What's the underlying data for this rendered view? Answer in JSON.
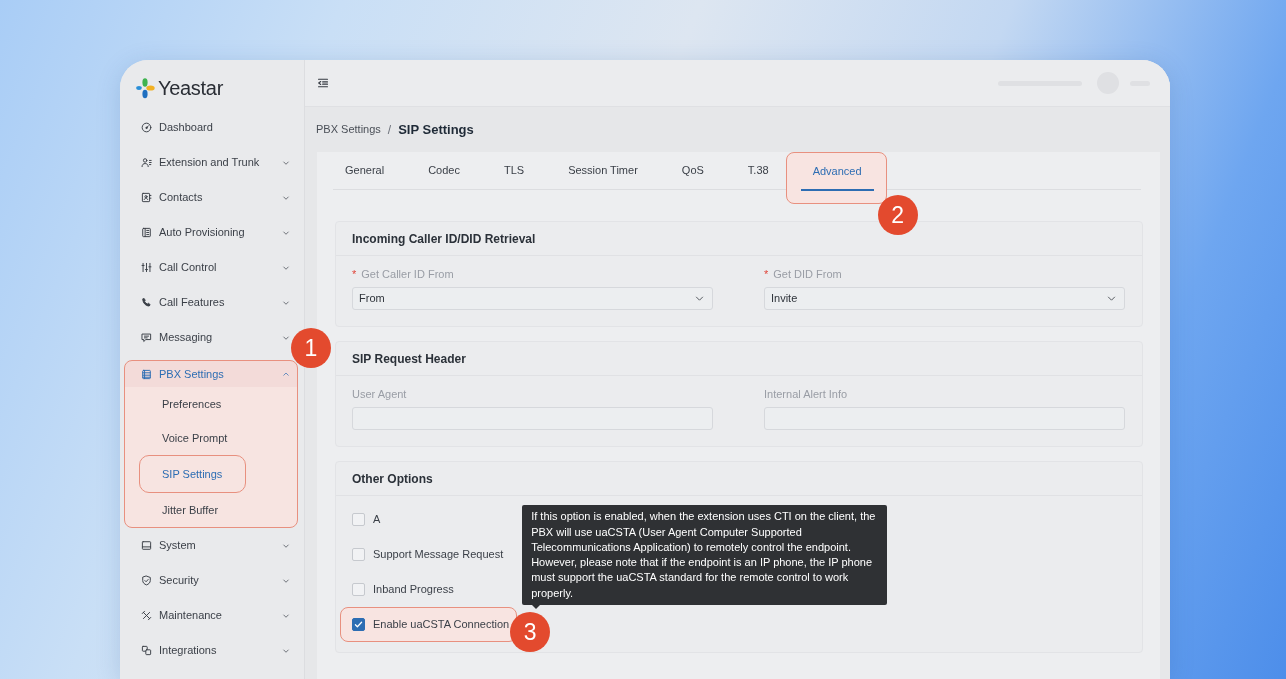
{
  "sidebar": {
    "logo_text": "Yeastar",
    "items": [
      {
        "label": "Dashboard",
        "kind": "link",
        "selected": false,
        "highlighted": false
      },
      {
        "label": "Extension and Trunk",
        "kind": "group",
        "expanded": false,
        "selected": false,
        "highlighted": false
      },
      {
        "label": "Contacts",
        "kind": "group",
        "expanded": false,
        "selected": false,
        "highlighted": false
      },
      {
        "label": "Auto Provisioning",
        "kind": "group",
        "expanded": false,
        "selected": false,
        "highlighted": false
      },
      {
        "label": "Call Control",
        "kind": "group",
        "expanded": false,
        "selected": false,
        "highlighted": false
      },
      {
        "label": "Call Features",
        "kind": "group",
        "expanded": false,
        "selected": false,
        "highlighted": false
      },
      {
        "label": "Messaging",
        "kind": "group",
        "expanded": false,
        "selected": false,
        "highlighted": false
      },
      {
        "label": "PBX Settings",
        "kind": "group",
        "expanded": true,
        "selected": true,
        "highlighted": true,
        "step_badge": "1",
        "children": [
          {
            "label": "Preferences",
            "selected": false,
            "highlighted": false
          },
          {
            "label": "Voice Prompt",
            "selected": false,
            "highlighted": false
          },
          {
            "label": "SIP Settings",
            "selected": true,
            "highlighted": true
          },
          {
            "label": "Jitter Buffer",
            "selected": false,
            "highlighted": false
          }
        ]
      },
      {
        "label": "System",
        "kind": "group",
        "expanded": false,
        "selected": false,
        "highlighted": false
      },
      {
        "label": "Security",
        "kind": "group",
        "expanded": false,
        "selected": false,
        "highlighted": false
      },
      {
        "label": "Maintenance",
        "kind": "group",
        "expanded": false,
        "selected": false,
        "highlighted": false
      },
      {
        "label": "Integrations",
        "kind": "group",
        "expanded": false,
        "selected": false,
        "highlighted": false
      }
    ]
  },
  "breadcrumb": {
    "parent": "PBX Settings",
    "separator": "/",
    "current": "SIP Settings"
  },
  "tabs": [
    {
      "label": "General",
      "selected": false,
      "highlighted": false
    },
    {
      "label": "Codec",
      "selected": false,
      "highlighted": false
    },
    {
      "label": "TLS",
      "selected": false,
      "highlighted": false
    },
    {
      "label": "Session Timer",
      "selected": false,
      "highlighted": false
    },
    {
      "label": "QoS",
      "selected": false,
      "highlighted": false
    },
    {
      "label": "T.38",
      "selected": false,
      "highlighted": false
    },
    {
      "label": "Advanced",
      "selected": true,
      "highlighted": true,
      "step_badge": "2"
    }
  ],
  "sections": [
    {
      "title": "Incoming Caller ID/DID Retrieval",
      "kind": "fields",
      "fields": [
        {
          "label": "Get Caller ID From",
          "required_mark": "*",
          "kind": "select",
          "value": "From"
        },
        {
          "label": "Get DID From",
          "required_mark": "*",
          "kind": "select",
          "value": "Invite"
        }
      ]
    },
    {
      "title": "SIP Request Header",
      "kind": "fields",
      "fields": [
        {
          "label": "User Agent",
          "kind": "text"
        },
        {
          "label": "Internal Alert Info",
          "kind": "text"
        }
      ]
    },
    {
      "title": "Other Options",
      "kind": "options",
      "options": [
        {
          "label": "A",
          "checked": false,
          "highlighted": false
        },
        {
          "label": "Support Message Request",
          "checked": false,
          "highlighted": false
        },
        {
          "label": "Inband Progress",
          "checked": false,
          "highlighted": false
        },
        {
          "label": "Enable uaCSTA Connection",
          "checked": true,
          "highlighted": true,
          "step_badge": "3",
          "tooltip": "If this option is enabled, when the extension uses CTI on the client, the PBX will use uaCSTA (User Agent Computer Supported Telecommunications Application) to remotely control the endpoint. However, please note that if the endpoint is an IP phone, the IP phone must support the uaCSTA standard for the remote control to work properly."
        }
      ]
    }
  ]
}
